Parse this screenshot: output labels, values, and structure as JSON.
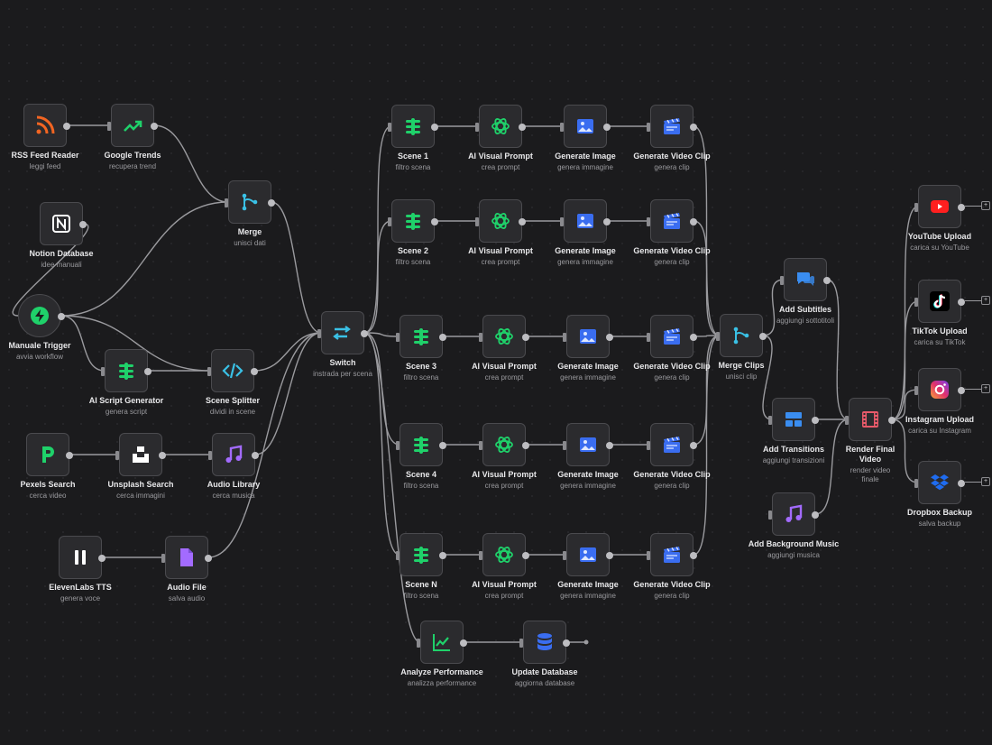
{
  "workflow": {
    "nodes": [
      {
        "id": "rss",
        "title": "RSS Feed Reader",
        "subtitle": "leggi feed",
        "icon": "rss-icon",
        "color": "#f26522"
      },
      {
        "id": "gtrends",
        "title": "Google Trends",
        "subtitle": "recupera trend",
        "icon": "trend-icon",
        "color": "#1fd16a"
      },
      {
        "id": "notion",
        "title": "Notion Database",
        "subtitle": "idee manuali",
        "icon": "notion-icon",
        "color": "#ffffff"
      },
      {
        "id": "merge",
        "title": "Merge",
        "subtitle": "unisci dati",
        "icon": "merge-icon",
        "color": "#3ac1e6"
      },
      {
        "id": "trigger",
        "title": "Manuale Trigger",
        "subtitle": "avvia workflow",
        "icon": "bolt-icon",
        "color": "#1fd16a"
      },
      {
        "id": "aiscript",
        "title": "AI Script Generator",
        "subtitle": "genera script",
        "icon": "sliders-icon",
        "color": "#1fd16a"
      },
      {
        "id": "splitter",
        "title": "Scene Splitter",
        "subtitle": "dividi in scene",
        "icon": "code-icon",
        "color": "#3ac1e6"
      },
      {
        "id": "pexels",
        "title": "Pexels Search",
        "subtitle": "cerca video",
        "icon": "pexels-icon",
        "color": "#1fd16a"
      },
      {
        "id": "unsplash",
        "title": "Unsplash Search",
        "subtitle": "cerca immagini",
        "icon": "unsplash-icon",
        "color": "#ffffff"
      },
      {
        "id": "audiolib",
        "title": "Audio Library",
        "subtitle": "cerca musica",
        "icon": "music-icon",
        "color": "#a36bff"
      },
      {
        "id": "eleven",
        "title": "ElevenLabs TTS",
        "subtitle": "genera voce",
        "icon": "pause-icon",
        "color": "#ffffff"
      },
      {
        "id": "audiofile",
        "title": "Audio File",
        "subtitle": "salva audio",
        "icon": "file-icon",
        "color": "#a36bff"
      },
      {
        "id": "switch",
        "title": "Switch",
        "subtitle": "instrada per scena",
        "icon": "switch-icon",
        "color": "#3ac1e6"
      },
      {
        "id": "scene1",
        "title": "Scene 1",
        "subtitle": "filtro scena",
        "icon": "sliders-icon",
        "color": "#1fd16a"
      },
      {
        "id": "aip1",
        "title": "AI Visual Prompt",
        "subtitle": "crea prompt",
        "icon": "openai-icon",
        "color": "#1fd16a"
      },
      {
        "id": "gi1",
        "title": "Generate Image",
        "subtitle": "genera immagine",
        "icon": "image-icon",
        "color": "#3a6df0"
      },
      {
        "id": "gv1",
        "title": "Generate Video Clip",
        "subtitle": "genera clip",
        "icon": "clapper-icon",
        "color": "#3a6df0"
      },
      {
        "id": "scene2",
        "title": "Scene 2",
        "subtitle": "filtro scena",
        "icon": "sliders-icon",
        "color": "#1fd16a"
      },
      {
        "id": "aip2",
        "title": "AI Visual Prompt",
        "subtitle": "crea prompt",
        "icon": "openai-icon",
        "color": "#1fd16a"
      },
      {
        "id": "gi2",
        "title": "Generate Image",
        "subtitle": "genera immagine",
        "icon": "image-icon",
        "color": "#3a6df0"
      },
      {
        "id": "gv2",
        "title": "Generate Video Clip",
        "subtitle": "genera clip",
        "icon": "clapper-icon",
        "color": "#3a6df0"
      },
      {
        "id": "scene3",
        "title": "Scene 3",
        "subtitle": "filtro scena",
        "icon": "sliders-icon",
        "color": "#1fd16a"
      },
      {
        "id": "aip3",
        "title": "AI Visual Prompt",
        "subtitle": "crea prompt",
        "icon": "openai-icon",
        "color": "#1fd16a"
      },
      {
        "id": "gi3",
        "title": "Generate Image",
        "subtitle": "genera immagine",
        "icon": "image-icon",
        "color": "#3a6df0"
      },
      {
        "id": "gv3",
        "title": "Generate Video Clip",
        "subtitle": "genera clip",
        "icon": "clapper-icon",
        "color": "#3a6df0"
      },
      {
        "id": "scene4",
        "title": "Scene 4",
        "subtitle": "filtro scena",
        "icon": "sliders-icon",
        "color": "#1fd16a"
      },
      {
        "id": "aip4",
        "title": "AI Visual Prompt",
        "subtitle": "crea prompt",
        "icon": "openai-icon",
        "color": "#1fd16a"
      },
      {
        "id": "gi4",
        "title": "Generate Image",
        "subtitle": "genera immagine",
        "icon": "image-icon",
        "color": "#3a6df0"
      },
      {
        "id": "gv4",
        "title": "Generate Video Clip",
        "subtitle": "genera clip",
        "icon": "clapper-icon",
        "color": "#3a6df0"
      },
      {
        "id": "sceneN",
        "title": "Scene N",
        "subtitle": "filtro scena",
        "icon": "sliders-icon",
        "color": "#1fd16a"
      },
      {
        "id": "aipN",
        "title": "AI Visual Prompt",
        "subtitle": "crea prompt",
        "icon": "openai-icon",
        "color": "#1fd16a"
      },
      {
        "id": "giN",
        "title": "Generate Image",
        "subtitle": "genera immagine",
        "icon": "image-icon",
        "color": "#3a6df0"
      },
      {
        "id": "gvN",
        "title": "Generate Video Clip",
        "subtitle": "genera clip",
        "icon": "clapper-icon",
        "color": "#3a6df0"
      },
      {
        "id": "mergeclips",
        "title": "Merge Clips",
        "subtitle": "unisci clip",
        "icon": "merge-icon",
        "color": "#3ac1e6"
      },
      {
        "id": "subtitles",
        "title": "Add Subtitles",
        "subtitle": "aggiungi sottotitoli",
        "icon": "chat-icon",
        "color": "#3a8df0"
      },
      {
        "id": "transitions",
        "title": "Add Transitions",
        "subtitle": "aggiungi transizioni",
        "icon": "layout-icon",
        "color": "#3a8df0"
      },
      {
        "id": "bgmusic",
        "title": "Add Background Music",
        "subtitle": "aggiungi musica",
        "icon": "music-icon",
        "color": "#a36bff"
      },
      {
        "id": "render",
        "title": "Render Final Video",
        "subtitle": "render video finale",
        "icon": "film-icon",
        "color": "#e85a6a"
      },
      {
        "id": "youtube",
        "title": "YouTube Upload",
        "subtitle": "carica su YouTube",
        "icon": "youtube-icon",
        "color": "#ff1f1f"
      },
      {
        "id": "tiktok",
        "title": "TikTok Upload",
        "subtitle": "carica su TikTok",
        "icon": "tiktok-icon",
        "color": "#ffffff"
      },
      {
        "id": "instagram",
        "title": "Instagram Upload",
        "subtitle": "carica su Instagram",
        "icon": "instagram-icon",
        "color": "#e1306c"
      },
      {
        "id": "dropbox",
        "title": "Dropbox Backup",
        "subtitle": "salva backup",
        "icon": "dropbox-icon",
        "color": "#1f6cf0"
      },
      {
        "id": "analyze",
        "title": "Analyze Performance",
        "subtitle": "analizza performance",
        "icon": "chart-icon",
        "color": "#1fd16a"
      },
      {
        "id": "updatedb",
        "title": "Update Database",
        "subtitle": "aggiorna database",
        "icon": "database-icon",
        "color": "#3a6df0"
      }
    ],
    "connections": [
      [
        "rss",
        "gtrends"
      ],
      [
        "gtrends",
        "merge"
      ],
      [
        "notion",
        "trigger"
      ],
      [
        "trigger",
        "merge"
      ],
      [
        "merge",
        "switch"
      ],
      [
        "trigger",
        "aiscript"
      ],
      [
        "trigger",
        "splitter"
      ],
      [
        "aiscript",
        "splitter"
      ],
      [
        "splitter",
        "switch"
      ],
      [
        "pexels",
        "unsplash"
      ],
      [
        "unsplash",
        "audiolib"
      ],
      [
        "audiolib",
        "switch"
      ],
      [
        "eleven",
        "audiofile"
      ],
      [
        "audiofile",
        "switch"
      ],
      [
        "switch",
        "scene1"
      ],
      [
        "switch",
        "scene2"
      ],
      [
        "switch",
        "scene3"
      ],
      [
        "switch",
        "scene4"
      ],
      [
        "switch",
        "sceneN"
      ],
      [
        "switch",
        "analyze"
      ],
      [
        "scene1",
        "aip1"
      ],
      [
        "aip1",
        "gi1"
      ],
      [
        "gi1",
        "gv1"
      ],
      [
        "scene2",
        "aip2"
      ],
      [
        "aip2",
        "gi2"
      ],
      [
        "gi2",
        "gv2"
      ],
      [
        "scene3",
        "aip3"
      ],
      [
        "aip3",
        "gi3"
      ],
      [
        "gi3",
        "gv3"
      ],
      [
        "scene4",
        "aip4"
      ],
      [
        "aip4",
        "gi4"
      ],
      [
        "gi4",
        "gv4"
      ],
      [
        "sceneN",
        "aipN"
      ],
      [
        "aipN",
        "giN"
      ],
      [
        "giN",
        "gvN"
      ],
      [
        "gv1",
        "mergeclips"
      ],
      [
        "gv2",
        "mergeclips"
      ],
      [
        "gv3",
        "mergeclips"
      ],
      [
        "gv4",
        "mergeclips"
      ],
      [
        "gvN",
        "mergeclips"
      ],
      [
        "mergeclips",
        "subtitles"
      ],
      [
        "mergeclips",
        "transitions"
      ],
      [
        "subtitles",
        "render"
      ],
      [
        "transitions",
        "render"
      ],
      [
        "bgmusic",
        "render"
      ],
      [
        "render",
        "youtube"
      ],
      [
        "render",
        "tiktok"
      ],
      [
        "render",
        "instagram"
      ],
      [
        "render",
        "dropbox"
      ],
      [
        "analyze",
        "updatedb"
      ]
    ]
  }
}
